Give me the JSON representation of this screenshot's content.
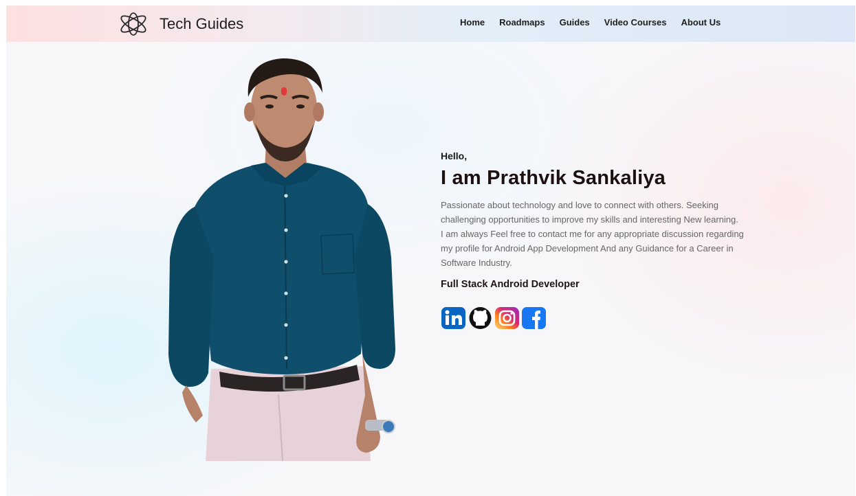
{
  "brand": {
    "name": "Tech Guides",
    "logo_icon": "atom-icon"
  },
  "nav": {
    "items": [
      {
        "label": "Home"
      },
      {
        "label": "Roadmaps"
      },
      {
        "label": "Guides"
      },
      {
        "label": "Video Courses"
      },
      {
        "label": "About Us"
      }
    ]
  },
  "hero": {
    "greeting": "Hello,",
    "name": "I am Prathvik Sankaliya",
    "bio_1": "Passionate about technology and love to connect with others. Seeking challenging opportunities to improve my skills and interesting New learning.",
    "bio_2": "I am always Feel free to contact me for any appropriate discussion regarding my profile for Android App Development And any Guidance for a Career in Software Industry.",
    "role": "Full Stack Android Developer"
  },
  "socials": [
    {
      "icon": "linkedin-icon",
      "color": "#0a66c2"
    },
    {
      "icon": "github-icon",
      "color": "#111111"
    },
    {
      "icon": "instagram-icon",
      "color": "#e1306c"
    },
    {
      "icon": "facebook-icon",
      "color": "#1877f2"
    }
  ],
  "colors": {
    "heading": "#1c1010",
    "body_text": "#666666"
  }
}
